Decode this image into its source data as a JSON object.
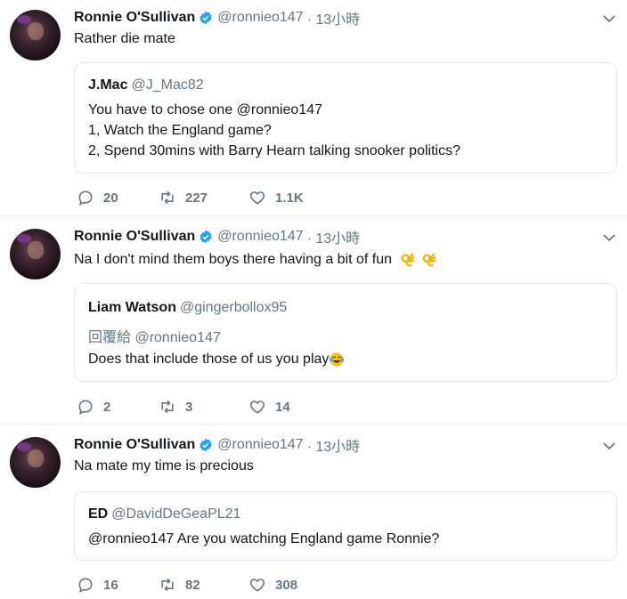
{
  "tweets": [
    {
      "name": "Ronnie O'Sullivan",
      "handle": "@ronnieo147",
      "time": "· 13小時",
      "text": "Rather die mate",
      "quote": {
        "name": "J.Mac",
        "handle": "@J_Mac82",
        "lines": [
          "You have to chose one @ronnieo147",
          "1, Watch the England game?",
          "2, Spend 30mins with Barry Hearn talking snooker politics?"
        ]
      },
      "replies": "20",
      "retweets": "227",
      "likes": "1.1K"
    },
    {
      "name": "Ronnie O'Sullivan",
      "handle": "@ronnieo147",
      "time": "· 13小時",
      "text": "Na I don't mind them boys there having a bit of fun",
      "text_emoji": "ok-hand-icon ok-hand-icon",
      "quote": {
        "name": "Liam Watson",
        "handle": "@gingerbollox95",
        "reply_to": "回覆給 @ronnieo147",
        "lines": [
          "Does that include those of us you play"
        ],
        "emoji": "face-with-tears-of-joy-icon"
      },
      "replies": "2",
      "retweets": "3",
      "likes": "14"
    },
    {
      "name": "Ronnie O'Sullivan",
      "handle": "@ronnieo147",
      "time": "· 13小時",
      "text": "Na mate my time is precious",
      "quote": {
        "name": "ED",
        "handle": "@DavidDeGeaPL21",
        "lines": [
          "@ronnieo147 Are you watching England game Ronnie?"
        ]
      },
      "replies": "16",
      "retweets": "82",
      "likes": "308"
    }
  ],
  "colors": {
    "verified": "#1da1f2",
    "secondary_text": "#657786",
    "border": "#e1e8ed",
    "divider": "#e6ecf0"
  }
}
